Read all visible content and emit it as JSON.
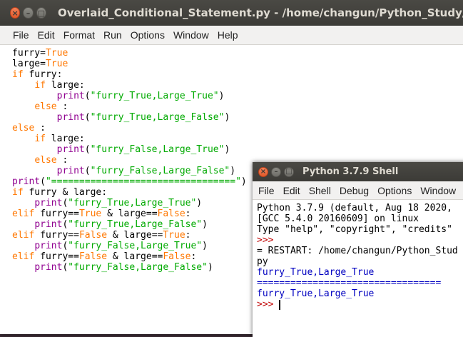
{
  "editor": {
    "title": "Overlaid_Conditional_Statement.py - /home/changun/Python_Study/chapter_",
    "menus": [
      "File",
      "Edit",
      "Format",
      "Run",
      "Options",
      "Window",
      "Help"
    ],
    "lines": [
      [
        {
          "t": "furry="
        },
        {
          "t": "True",
          "c": "kw"
        }
      ],
      [
        {
          "t": "large="
        },
        {
          "t": "True",
          "c": "kw"
        }
      ],
      [
        {
          "t": "if",
          "c": "kw"
        },
        {
          "t": " furry:"
        }
      ],
      [
        {
          "t": "    "
        },
        {
          "t": "if",
          "c": "kw"
        },
        {
          "t": " large:"
        }
      ],
      [
        {
          "t": "        "
        },
        {
          "t": "print",
          "c": "bi"
        },
        {
          "t": "("
        },
        {
          "t": "\"furry_True,Large_True\"",
          "c": "st"
        },
        {
          "t": ")"
        }
      ],
      [
        {
          "t": "    "
        },
        {
          "t": "else",
          "c": "kw"
        },
        {
          "t": " :"
        }
      ],
      [
        {
          "t": "        "
        },
        {
          "t": "print",
          "c": "bi"
        },
        {
          "t": "("
        },
        {
          "t": "\"furry_True,Large_False\"",
          "c": "st"
        },
        {
          "t": ")"
        }
      ],
      [
        {
          "t": "else",
          "c": "kw"
        },
        {
          "t": " :"
        }
      ],
      [
        {
          "t": "    "
        },
        {
          "t": "if",
          "c": "kw"
        },
        {
          "t": " large:"
        }
      ],
      [
        {
          "t": "        "
        },
        {
          "t": "print",
          "c": "bi"
        },
        {
          "t": "("
        },
        {
          "t": "\"furry_False,Large_True\"",
          "c": "st"
        },
        {
          "t": ")"
        }
      ],
      [
        {
          "t": "    "
        },
        {
          "t": "else",
          "c": "kw"
        },
        {
          "t": " :"
        }
      ],
      [
        {
          "t": "        "
        },
        {
          "t": "print",
          "c": "bi"
        },
        {
          "t": "("
        },
        {
          "t": "\"furry_False,Large_False\"",
          "c": "st"
        },
        {
          "t": ")"
        }
      ],
      [
        {
          "t": "print",
          "c": "bi"
        },
        {
          "t": "("
        },
        {
          "t": "\"=================================\"",
          "c": "st"
        },
        {
          "t": ")"
        }
      ],
      [
        {
          "t": "if",
          "c": "kw"
        },
        {
          "t": " furry & large:"
        }
      ],
      [
        {
          "t": "    "
        },
        {
          "t": "print",
          "c": "bi"
        },
        {
          "t": "("
        },
        {
          "t": "\"furry_True,Large_True\"",
          "c": "st"
        },
        {
          "t": ")"
        }
      ],
      [
        {
          "t": "elif",
          "c": "kw"
        },
        {
          "t": " furry=="
        },
        {
          "t": "True",
          "c": "kw"
        },
        {
          "t": " & large=="
        },
        {
          "t": "False",
          "c": "kw"
        },
        {
          "t": ":"
        }
      ],
      [
        {
          "t": "    "
        },
        {
          "t": "print",
          "c": "bi"
        },
        {
          "t": "("
        },
        {
          "t": "\"furry_True,Large_False\"",
          "c": "st"
        },
        {
          "t": ")"
        }
      ],
      [
        {
          "t": "elif",
          "c": "kw"
        },
        {
          "t": " furry=="
        },
        {
          "t": "False",
          "c": "kw"
        },
        {
          "t": " & large=="
        },
        {
          "t": "True",
          "c": "kw"
        },
        {
          "t": ":"
        }
      ],
      [
        {
          "t": "    "
        },
        {
          "t": "print",
          "c": "bi"
        },
        {
          "t": "("
        },
        {
          "t": "\"furry_False,Large_True\"",
          "c": "st"
        },
        {
          "t": ")"
        }
      ],
      [
        {
          "t": "elif",
          "c": "kw"
        },
        {
          "t": " furry=="
        },
        {
          "t": "False",
          "c": "kw"
        },
        {
          "t": " & large=="
        },
        {
          "t": "False",
          "c": "kw"
        },
        {
          "t": ":"
        }
      ],
      [
        {
          "t": "    "
        },
        {
          "t": "print",
          "c": "bi"
        },
        {
          "t": "("
        },
        {
          "t": "\"furry_False,Large_False\"",
          "c": "st"
        },
        {
          "t": ")"
        }
      ]
    ]
  },
  "shell": {
    "title": "Python 3.7.9 Shell",
    "menus": [
      "File",
      "Edit",
      "Shell",
      "Debug",
      "Options",
      "Window",
      "H"
    ],
    "lines": [
      [
        {
          "t": "Python 3.7.9 (default, Aug 18 2020, "
        }
      ],
      [
        {
          "t": "[GCC 5.4.0 20160609] on linux"
        }
      ],
      [
        {
          "t": "Type \"help\", \"copyright\", \"credits\" "
        }
      ],
      [
        {
          "t": ">>> ",
          "c": "prompt"
        }
      ],
      [
        {
          "t": "= RESTART: /home/changun/Python_Stud"
        }
      ],
      [
        {
          "t": "py"
        }
      ],
      [
        {
          "t": "furry_True,Large_True",
          "c": "out"
        }
      ],
      [
        {
          "t": "=================================",
          "c": "out"
        }
      ],
      [
        {
          "t": "furry_True,Large_True",
          "c": "out"
        }
      ],
      [
        {
          "t": ">>> ",
          "c": "prompt"
        },
        {
          "caret": true
        }
      ]
    ]
  }
}
